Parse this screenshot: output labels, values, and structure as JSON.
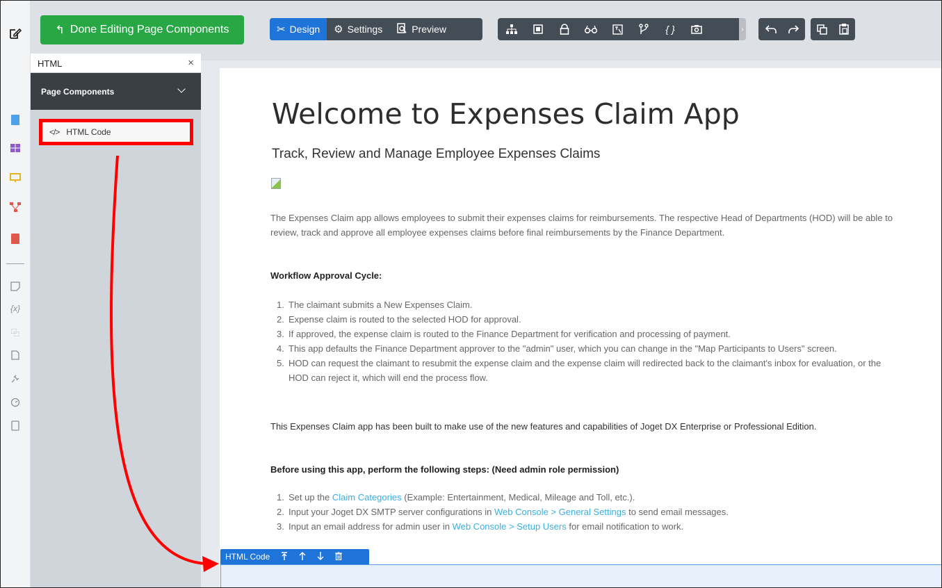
{
  "topbar": {
    "done_label": "Done Editing Page Components",
    "done_icon": "back-arrow-icon",
    "modes": [
      {
        "label": "Design",
        "icon": "design-tools-icon"
      },
      {
        "label": "Settings",
        "icon": "gear-icon"
      },
      {
        "label": "Preview",
        "icon": "preview-icon"
      }
    ],
    "tools": [
      "sitemap-icon",
      "form-icon",
      "lock-icon",
      "glasses-icon",
      "translate-icon",
      "branch-icon",
      "curly-braces-icon",
      "camera-icon"
    ],
    "history": [
      "undo-icon",
      "redo-icon"
    ],
    "clipboard": [
      "copy-icon",
      "paste-icon"
    ]
  },
  "rail": {
    "top_icon": "edit-icon",
    "icons": [
      "document-icon",
      "table-icon",
      "monitor-icon",
      "hierarchy-icon",
      "pdf-icon",
      "note-icon",
      "variable-icon",
      "translate-icon",
      "file-icon",
      "plug-icon",
      "speedometer-icon",
      "tablet-icon"
    ]
  },
  "panel": {
    "search_value": "HTML",
    "clear_glyph": "×",
    "section_title": "Page Components",
    "items": [
      {
        "label": "HTML Code",
        "icon": "code-icon"
      }
    ]
  },
  "canvas": {
    "title": "Welcome to Expenses Claim App",
    "subtitle": "Track, Review and Manage Employee Expenses Claims",
    "intro": "The Expenses Claim app allows employees to submit their expenses claims for reimbursements. The respective Head of Departments (HOD) will be able to review, track and approve all employee expenses claims before final reimbursements by the Finance Department.",
    "workflow_heading": "Workflow Approval Cycle:",
    "workflow_steps": [
      "The claimant submits a New Expenses Claim.",
      "Expense claim is routed to the selected HOD for approval.",
      "If approved, the expense claim is routed to the Finance Department for verification and processing of payment.",
      "This app defaults the Finance Department approver to the \"admin\" user, which you can change in the \"Map Participants to Users\" screen.",
      "HOD can request the claimant to resubmit the expense claim and the expense claim will redirected back to the claimant's inbox for evaluation, or the HOD can reject it, which will end the process flow."
    ],
    "built_text": "This Expenses Claim app has been built to make use of the new features and capabilities of Joget DX Enterprise or Professional Edition.",
    "before_heading": "Before using this app, perform the following steps: (Need admin role permission)",
    "before_steps": [
      {
        "pre": "Set up the ",
        "link": "Claim Categories",
        "post": " (Example: Entertainment, Medical, Mileage and Toll, etc.)."
      },
      {
        "pre": "Input your Joget DX SMTP server configurations in ",
        "link": "Web Console > General Settings",
        "post": " to send email messages."
      },
      {
        "pre": "Input an email address for admin user in ",
        "link": "Web Console > Setup Users",
        "post": " for email notification to work."
      }
    ],
    "component_label": "HTML Code",
    "component_actions": [
      "move-top-icon",
      "move-up-icon",
      "move-down-icon",
      "trash-icon"
    ]
  },
  "colors": {
    "done_green": "#28a745",
    "active_blue": "#1e74d9",
    "highlight_red": "#ff0000",
    "link_blue": "#3aaee0"
  }
}
